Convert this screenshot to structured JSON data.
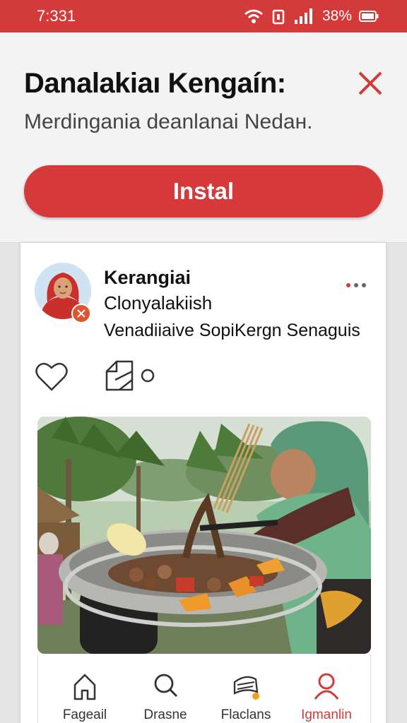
{
  "status_bar": {
    "time": "7:331",
    "battery": "38%"
  },
  "banner": {
    "title": "Danalakiaı Kengaín:",
    "subtitle": "Merdingania deanlanai  Nedaн.",
    "install_label": "Instal"
  },
  "post": {
    "name": "Kerangiai",
    "handle": "Clonyalakiish",
    "text": "Venadiiaive SopiKergn Senaguis"
  },
  "bottom_nav": {
    "items": [
      {
        "label": "Fageail",
        "icon": "home-icon"
      },
      {
        "label": "Drasne",
        "icon": "search-icon"
      },
      {
        "label": "Flaclans",
        "icon": "layers-icon"
      },
      {
        "label": "Igmanlin",
        "icon": "profile-icon",
        "active": true
      }
    ]
  },
  "colors": {
    "brand_red": "#d33a3a",
    "notification_dot": "#f0a11a"
  }
}
